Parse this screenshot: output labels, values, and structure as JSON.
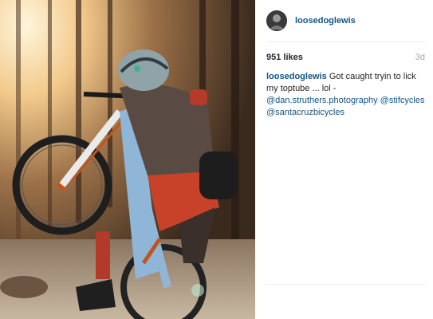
{
  "post": {
    "username": "loosedoglewis",
    "likes": "951 likes",
    "age": "3d",
    "caption": {
      "username": "loosedoglewis",
      "text": " Got caught tryin to lick my toptube ... lol - ",
      "mentions": [
        "@dan.struthers.photography",
        "@stifcycles",
        "@santacruzbicycles"
      ]
    }
  },
  "icons": {
    "avatar": "user-avatar",
    "photo": "mountain-bike-wheelie-photo"
  },
  "colors": {
    "link": "#125688",
    "muted": "#a5a7aa",
    "text": "#262626"
  }
}
